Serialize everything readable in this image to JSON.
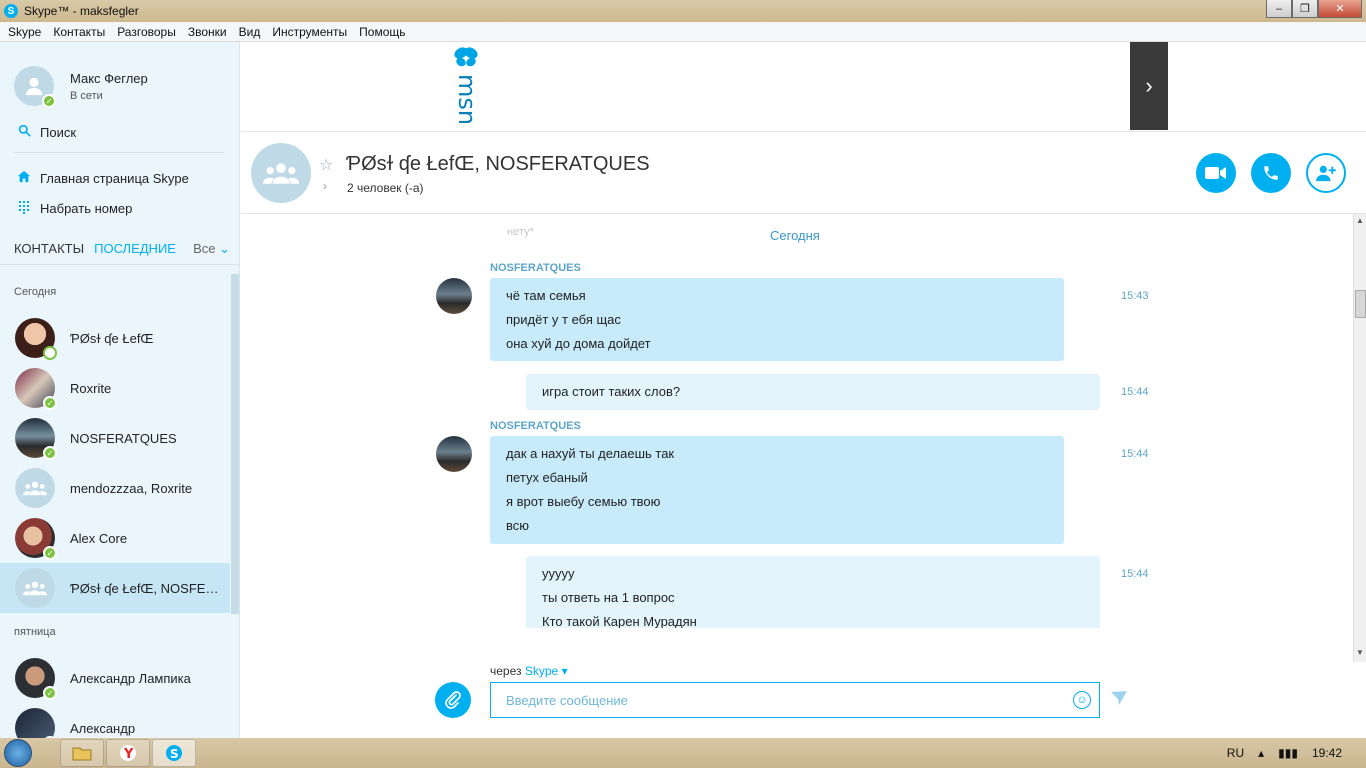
{
  "window": {
    "title": "Skype™ - maksfegler"
  },
  "menu": [
    "Skype",
    "Контакты",
    "Разговоры",
    "Звонки",
    "Вид",
    "Инструменты",
    "Помощь"
  ],
  "profile": {
    "name": "Макс Феглер",
    "status": "В сети"
  },
  "nav": {
    "search": "Поиск",
    "home": "Главная страница Skype",
    "dial": "Набрать номер"
  },
  "tabs": {
    "contacts": "КОНТАКТЫ",
    "recent": "ПОСЛЕДНИЕ",
    "filter": "Все"
  },
  "sections": {
    "today": "Сегодня",
    "friday": "пятница"
  },
  "contacts_today": [
    {
      "name": "ƤØsɫ ʠe ŁefŒ",
      "status": "away"
    },
    {
      "name": "Roxrite",
      "status": "online"
    },
    {
      "name": "NOSFERATQUES",
      "status": "online"
    },
    {
      "name": "mendozzzaa, Roxrite",
      "status": "group"
    },
    {
      "name": "Alex Core",
      "status": "online"
    },
    {
      "name": "ƤØsɫ ʠe ŁefŒ, NOSFERATQUES",
      "status": "group"
    }
  ],
  "contacts_friday": [
    {
      "name": "Александр Лампика",
      "status": "online"
    },
    {
      "name": "Александр",
      "status": "online"
    }
  ],
  "ad": {
    "brand": "msn"
  },
  "conversation": {
    "title": "ƤØsɫ ʠe ŁefŒ, NOSFERATQUES",
    "participants": "2 человек (-а)"
  },
  "chat": {
    "ghost": "нету*",
    "date": "Сегодня",
    "messages": [
      {
        "sender": "NOSFERATQUES",
        "lines": [
          "чё там семья",
          "придёт у т ебя щас",
          "она хуй до дома дойдет"
        ],
        "time": "15:43"
      },
      {
        "sender": "",
        "lines": [
          "игра стоит таких слов?"
        ],
        "time": "15:44"
      },
      {
        "sender": "NOSFERATQUES",
        "lines": [
          "дак а нахуй ты делаешь так",
          "петух ебаный",
          "я врот выебу семью твою",
          "всю"
        ],
        "time": "15:44"
      },
      {
        "sender": "",
        "lines": [
          "ууууу",
          "ты ответь на 1 вопрос",
          "Кто такой Карен Мурадян"
        ],
        "time": "15:44"
      }
    ]
  },
  "compose": {
    "via_label": "через",
    "via_service": "Skype",
    "placeholder": "Введите сообщение"
  },
  "taskbar": {
    "lang": "RU",
    "clock": "19:42"
  },
  "colors": {
    "accent": "#00aff0",
    "bubble_in": "#c8ebfb",
    "bubble_out": "#e3f4fc",
    "online": "#7dc242"
  }
}
